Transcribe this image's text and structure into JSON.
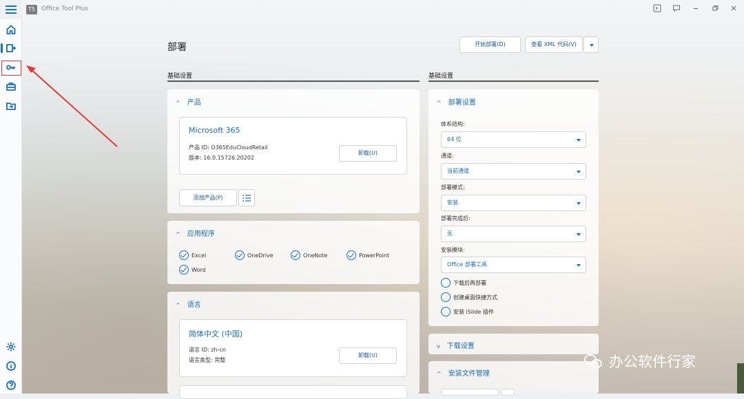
{
  "app": {
    "title": "Office Tool Plus",
    "logo_text": "T5"
  },
  "window_controls": [
    "terminal-icon",
    "feedback-icon",
    "minimize-icon",
    "restore-icon",
    "close-icon"
  ],
  "page": {
    "title": "部署",
    "start_button": "开始部署(D)",
    "xml_button": "查看 XML 代码(V)"
  },
  "left_section": {
    "heading": "基础设置"
  },
  "right_section": {
    "heading": "基础设置"
  },
  "products_card": {
    "title": "产品",
    "product_name": "Microsoft 365",
    "product_id": "产品 ID: O365EduCloudRetail",
    "version": "版本: 16.0.15726.20202",
    "uninstall": "卸载(U)",
    "add_product": "添加产品(P)"
  },
  "apps_card": {
    "title": "应用程序",
    "apps": [
      "Excel",
      "OneDrive",
      "OneNote",
      "PowerPoint",
      "Word"
    ]
  },
  "language_card": {
    "title": "语言",
    "language_name": "简体中文 (中国)",
    "language_id": "语言 ID: zh-cn",
    "language_type": "语言类型: 完整",
    "uninstall": "卸载(U)"
  },
  "deploy_settings": {
    "title": "部署设置",
    "arch_label": "体系结构:",
    "arch_value": "64 位",
    "channel_label": "通道:",
    "channel_value": "当前通道",
    "mode_label": "部署模式:",
    "mode_value": "安装",
    "after_label": "部署完成后:",
    "after_value": "无",
    "module_label": "安装模块:",
    "module_value": "Office 部署工具",
    "options": [
      "下载后再部署",
      "创建桌面快捷方式",
      "安装 iSlide 插件"
    ]
  },
  "download_settings": {
    "title": "下载设置"
  },
  "install_files": {
    "title": "安装文件管理"
  },
  "watermark": "办公软件行家",
  "colors": {
    "accent": "#1a6fc4",
    "highlight_box": "#e53935"
  }
}
